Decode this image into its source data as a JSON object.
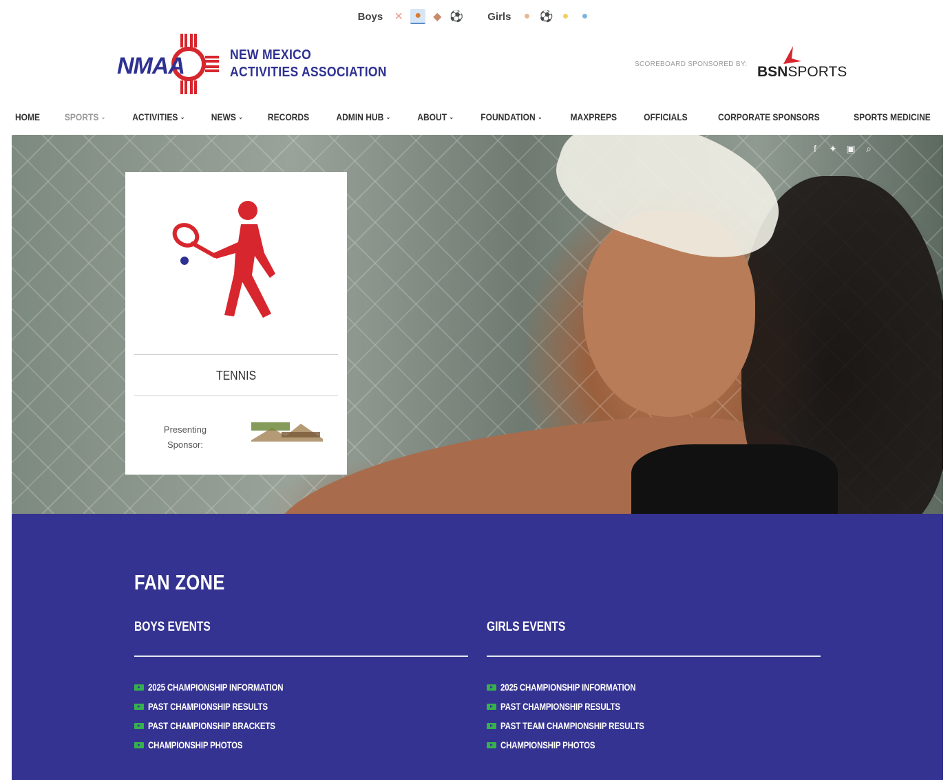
{
  "sports_bar": {
    "boys_label": "Boys",
    "girls_label": "Girls",
    "boys_icons": [
      {
        "name": "baseball-bats-icon",
        "glyph": "✕",
        "color": "#f0a090",
        "active": false
      },
      {
        "name": "basketball-icon",
        "glyph": "●",
        "color": "#e07a2e",
        "active": true
      },
      {
        "name": "football-icon",
        "glyph": "◆",
        "color": "#c98a6a",
        "active": false
      },
      {
        "name": "soccer-ball-icon",
        "glyph": "⚽",
        "color": "#b8b8b8",
        "active": false
      }
    ],
    "girls_icons": [
      {
        "name": "volleyball-icon",
        "glyph": "●",
        "color": "#e8b890",
        "active": false
      },
      {
        "name": "soccer-ball-icon",
        "glyph": "⚽",
        "color": "#b8b8b8",
        "active": false
      },
      {
        "name": "softball-icon",
        "glyph": "●",
        "color": "#f0d060",
        "active": false
      },
      {
        "name": "volleyball-blue-icon",
        "glyph": "●",
        "color": "#7fb3e0",
        "active": false
      }
    ]
  },
  "header": {
    "logo_abbr": "NMAA",
    "logo_line1": "NEW MEXICO",
    "logo_line2": "ACTIVITIES ASSOCIATION",
    "sponsor_label": "SCOREBOARD SPONSORED BY:",
    "sponsor_name_bold": "BSN",
    "sponsor_name_rest": "SPORTS",
    "brand_blue": "#2e3191",
    "brand_red": "#d7262d"
  },
  "nav": {
    "items": [
      {
        "label": "HOME",
        "dropdown": false,
        "muted": false
      },
      {
        "label": "SPORTS",
        "dropdown": true,
        "muted": true
      },
      {
        "label": "ACTIVITIES",
        "dropdown": true,
        "muted": false
      },
      {
        "label": "NEWS",
        "dropdown": true,
        "muted": false
      },
      {
        "label": "RECORDS",
        "dropdown": false,
        "muted": false
      },
      {
        "label": "ADMIN HUB",
        "dropdown": true,
        "muted": false
      },
      {
        "label": "ABOUT",
        "dropdown": true,
        "muted": false
      },
      {
        "label": "FOUNDATION",
        "dropdown": true,
        "muted": false
      },
      {
        "label": "MAXPREPS",
        "dropdown": false,
        "muted": false
      },
      {
        "label": "OFFICIALS",
        "dropdown": false,
        "muted": false
      },
      {
        "label": "CORPORATE SPONSORS",
        "dropdown": false,
        "muted": false
      },
      {
        "label": "SPORTS MEDICINE",
        "dropdown": false,
        "muted": false
      }
    ]
  },
  "hero": {
    "social_icons": [
      "facebook-icon",
      "twitter-icon",
      "youtube-icon",
      "search-icon"
    ],
    "card": {
      "sport_name": "TENNIS",
      "presenting_line1": "Presenting",
      "presenting_line2": "Sponsor:",
      "icon_color": "#d7262d",
      "ball_color": "#2e3191"
    }
  },
  "fanzone": {
    "title": "FAN ZONE",
    "bg_color": "#353391",
    "boys": {
      "heading": "BOYS EVENTS",
      "links": [
        "2025 CHAMPIONSHIP INFORMATION",
        "PAST CHAMPIONSHIP RESULTS",
        "PAST CHAMPIONSHIP BRACKETS",
        "CHAMPIONSHIP PHOTOS"
      ]
    },
    "girls": {
      "heading": "GIRLS EVENTS",
      "links": [
        "2025 CHAMPIONSHIP INFORMATION",
        "PAST CHAMPIONSHIP RESULTS",
        "PAST TEAM CHAMPIONSHIP RESULTS",
        "CHAMPIONSHIP PHOTOS"
      ]
    }
  }
}
